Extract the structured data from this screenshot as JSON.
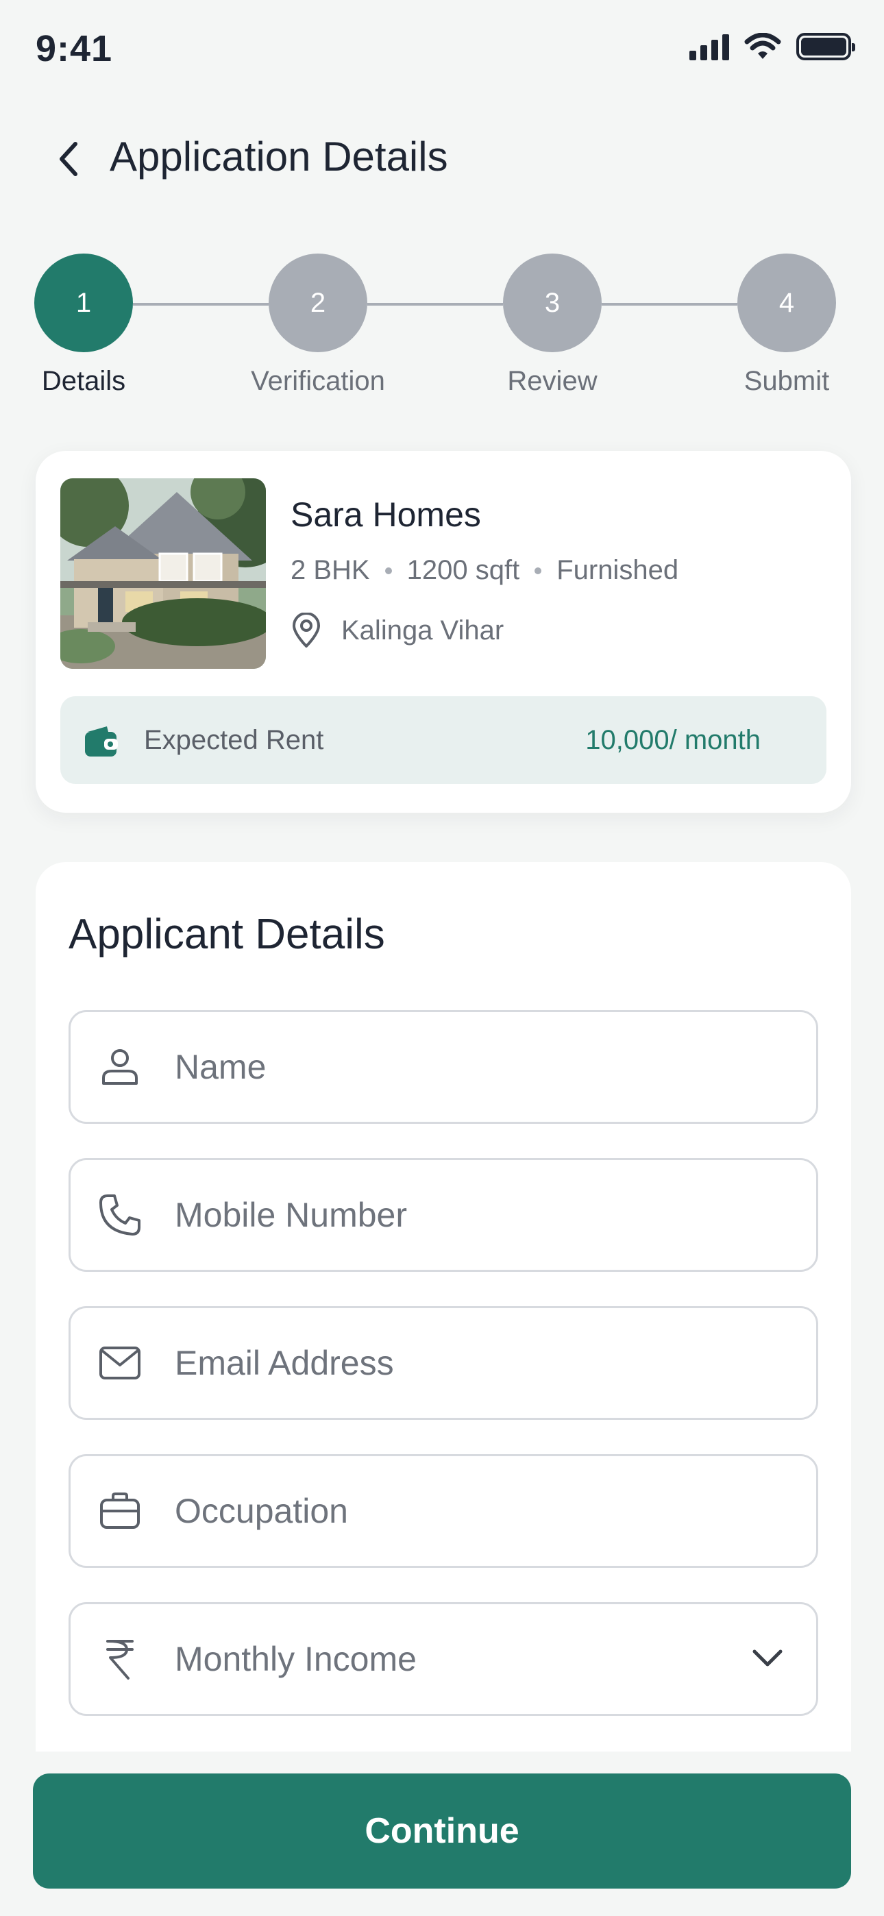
{
  "status_bar": {
    "time": "9:41"
  },
  "header": {
    "title": "Application Details"
  },
  "stepper": {
    "steps": [
      {
        "number": "1",
        "label": "Details",
        "active": true
      },
      {
        "number": "2",
        "label": "Verification",
        "active": false
      },
      {
        "number": "3",
        "label": "Review",
        "active": false
      },
      {
        "number": "4",
        "label": "Submit",
        "active": false
      }
    ]
  },
  "property": {
    "name": "Sara Homes",
    "bhk": "2 BHK",
    "area": "1200 sqft",
    "furnishing": "Furnished",
    "location": "Kalinga Vihar",
    "rent_label": "Expected Rent",
    "rent_value": "10,000/ month"
  },
  "form": {
    "title": "Applicant Details",
    "fields": [
      {
        "icon": "user-icon",
        "placeholder": "Name",
        "value": ""
      },
      {
        "icon": "phone-icon",
        "placeholder": "Mobile Number",
        "value": ""
      },
      {
        "icon": "mail-icon",
        "placeholder": "Email Address",
        "value": ""
      },
      {
        "icon": "briefcase-icon",
        "placeholder": "Occupation",
        "value": ""
      },
      {
        "icon": "rupee-icon",
        "placeholder": "Monthly Income",
        "value": ""
      }
    ]
  },
  "actions": {
    "continue_label": "Continue"
  },
  "colors": {
    "accent": "#227b6b",
    "background": "#f4f6f5",
    "inactive_step": "#a8adb5",
    "rent_bar": "#e8f0ef",
    "text_primary": "#1e2533",
    "text_secondary": "#6b7079"
  }
}
